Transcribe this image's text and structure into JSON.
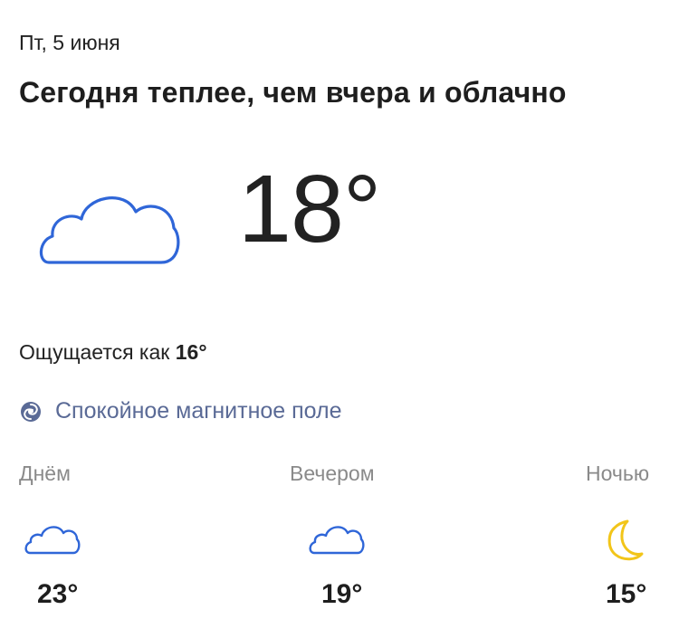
{
  "header": {
    "date": "Пт, 5 июня",
    "summary": "Сегодня теплее, чем вчера и облачно"
  },
  "current": {
    "icon": "cloud-icon",
    "temperature": "18°",
    "feels_like_label": "Ощущается как",
    "feels_like_value": "16°"
  },
  "magnetic": {
    "icon": "magnetic-field-icon",
    "text": "Спокойное магнитное поле"
  },
  "day_parts": [
    {
      "label": "Днём",
      "icon": "cloud-icon",
      "temperature": "23°"
    },
    {
      "label": "Вечером",
      "icon": "cloud-icon",
      "temperature": "19°"
    },
    {
      "label": "Ночью",
      "icon": "moon-icon",
      "temperature": "15°"
    }
  ],
  "colors": {
    "cloud": "#2f66d8",
    "moon": "#f2c519",
    "magnetic_text": "#5a6a96",
    "muted_label": "#8a8a8a"
  }
}
